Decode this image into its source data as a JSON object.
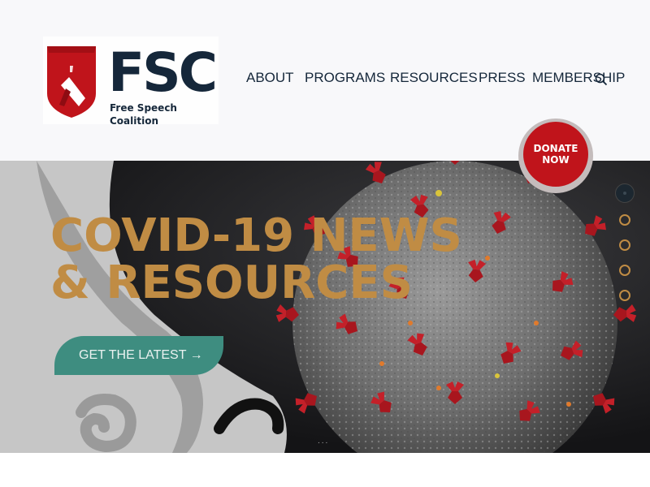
{
  "brand": {
    "name": "FSC",
    "subtitle": "Free Speech Coalition",
    "shield_color": "#c0141b",
    "text_color": "#15273a"
  },
  "nav": {
    "items": [
      {
        "label": "ABOUT"
      },
      {
        "label": "PROGRAMS"
      },
      {
        "label": "RESOURCES"
      },
      {
        "label": "PRESS"
      },
      {
        "label": "MEMBERSHIP"
      }
    ],
    "search_icon": "search-icon"
  },
  "donate": {
    "label": "DONATE\nNOW",
    "color": "#c0141b"
  },
  "hero": {
    "title": "COVID-19 NEWS\n& RESOURCES",
    "title_color": "#c08c44",
    "cta_label": "GET THE LATEST →",
    "cta_color": "#3e8d80",
    "slides_total": 5,
    "active_slide": 1,
    "scroll_indicator": "..."
  }
}
